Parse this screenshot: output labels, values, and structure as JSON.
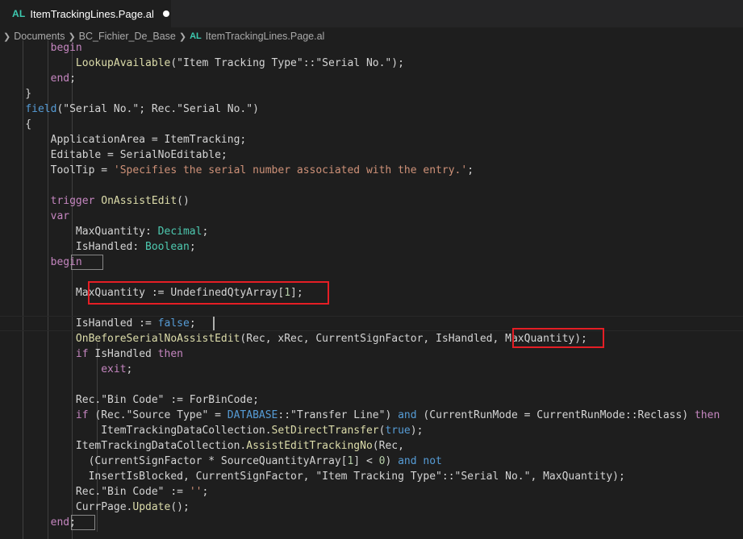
{
  "tab": {
    "badge": "AL",
    "title": "ItemTrackingLines.Page.al"
  },
  "breadcrumb": {
    "parts": [
      "Documents",
      "BC_Fichier_De_Base",
      "ItemTrackingLines.Page.al"
    ],
    "file_badge": "AL"
  },
  "code_lines": [
    "        begin",
    "            LookupAvailable(\"Item Tracking Type\"::\"Serial No.\");",
    "        end;",
    "    }",
    "    field(\"Serial No.\"; Rec.\"Serial No.\")",
    "    {",
    "        ApplicationArea = ItemTracking;",
    "        Editable = SerialNoEditable;",
    "        ToolTip = 'Specifies the serial number associated with the entry.';",
    "",
    "        trigger OnAssistEdit()",
    "        var",
    "            MaxQuantity: Decimal;",
    "            IsHandled: Boolean;",
    "        begin",
    "",
    "            MaxQuantity := UndefinedQtyArray[1];",
    "",
    "            IsHandled := false;",
    "            OnBeforeSerialNoAssistEdit(Rec, xRec, CurrentSignFactor, IsHandled, MaxQuantity);",
    "            if IsHandled then",
    "                exit;",
    "",
    "            Rec.\"Bin Code\" := ForBinCode;",
    "            if (Rec.\"Source Type\" = DATABASE::\"Transfer Line\") and (CurrentRunMode = CurrentRunMode::Reclass) then",
    "                ItemTrackingDataCollection.SetDirectTransfer(true);",
    "            ItemTrackingDataCollection.AssistEditTrackingNo(Rec,",
    "              (CurrentSignFactor * SourceQuantityArray[1] < 0) and not",
    "              InsertIsBlocked, CurrentSignFactor, \"Item Tracking Type\"::\"Serial No.\", MaxQuantity);",
    "            Rec.\"Bin Code\" := '';",
    "            CurrPage.Update();",
    "        end;"
  ],
  "colors": {
    "background": "#1e1e1e",
    "keyword": "#569cd6",
    "control": "#c586c0",
    "string": "#ce9178",
    "type": "#4ec9b0",
    "function": "#dcdcaa",
    "number": "#b5cea8",
    "highlight_box": "#e51e25"
  }
}
